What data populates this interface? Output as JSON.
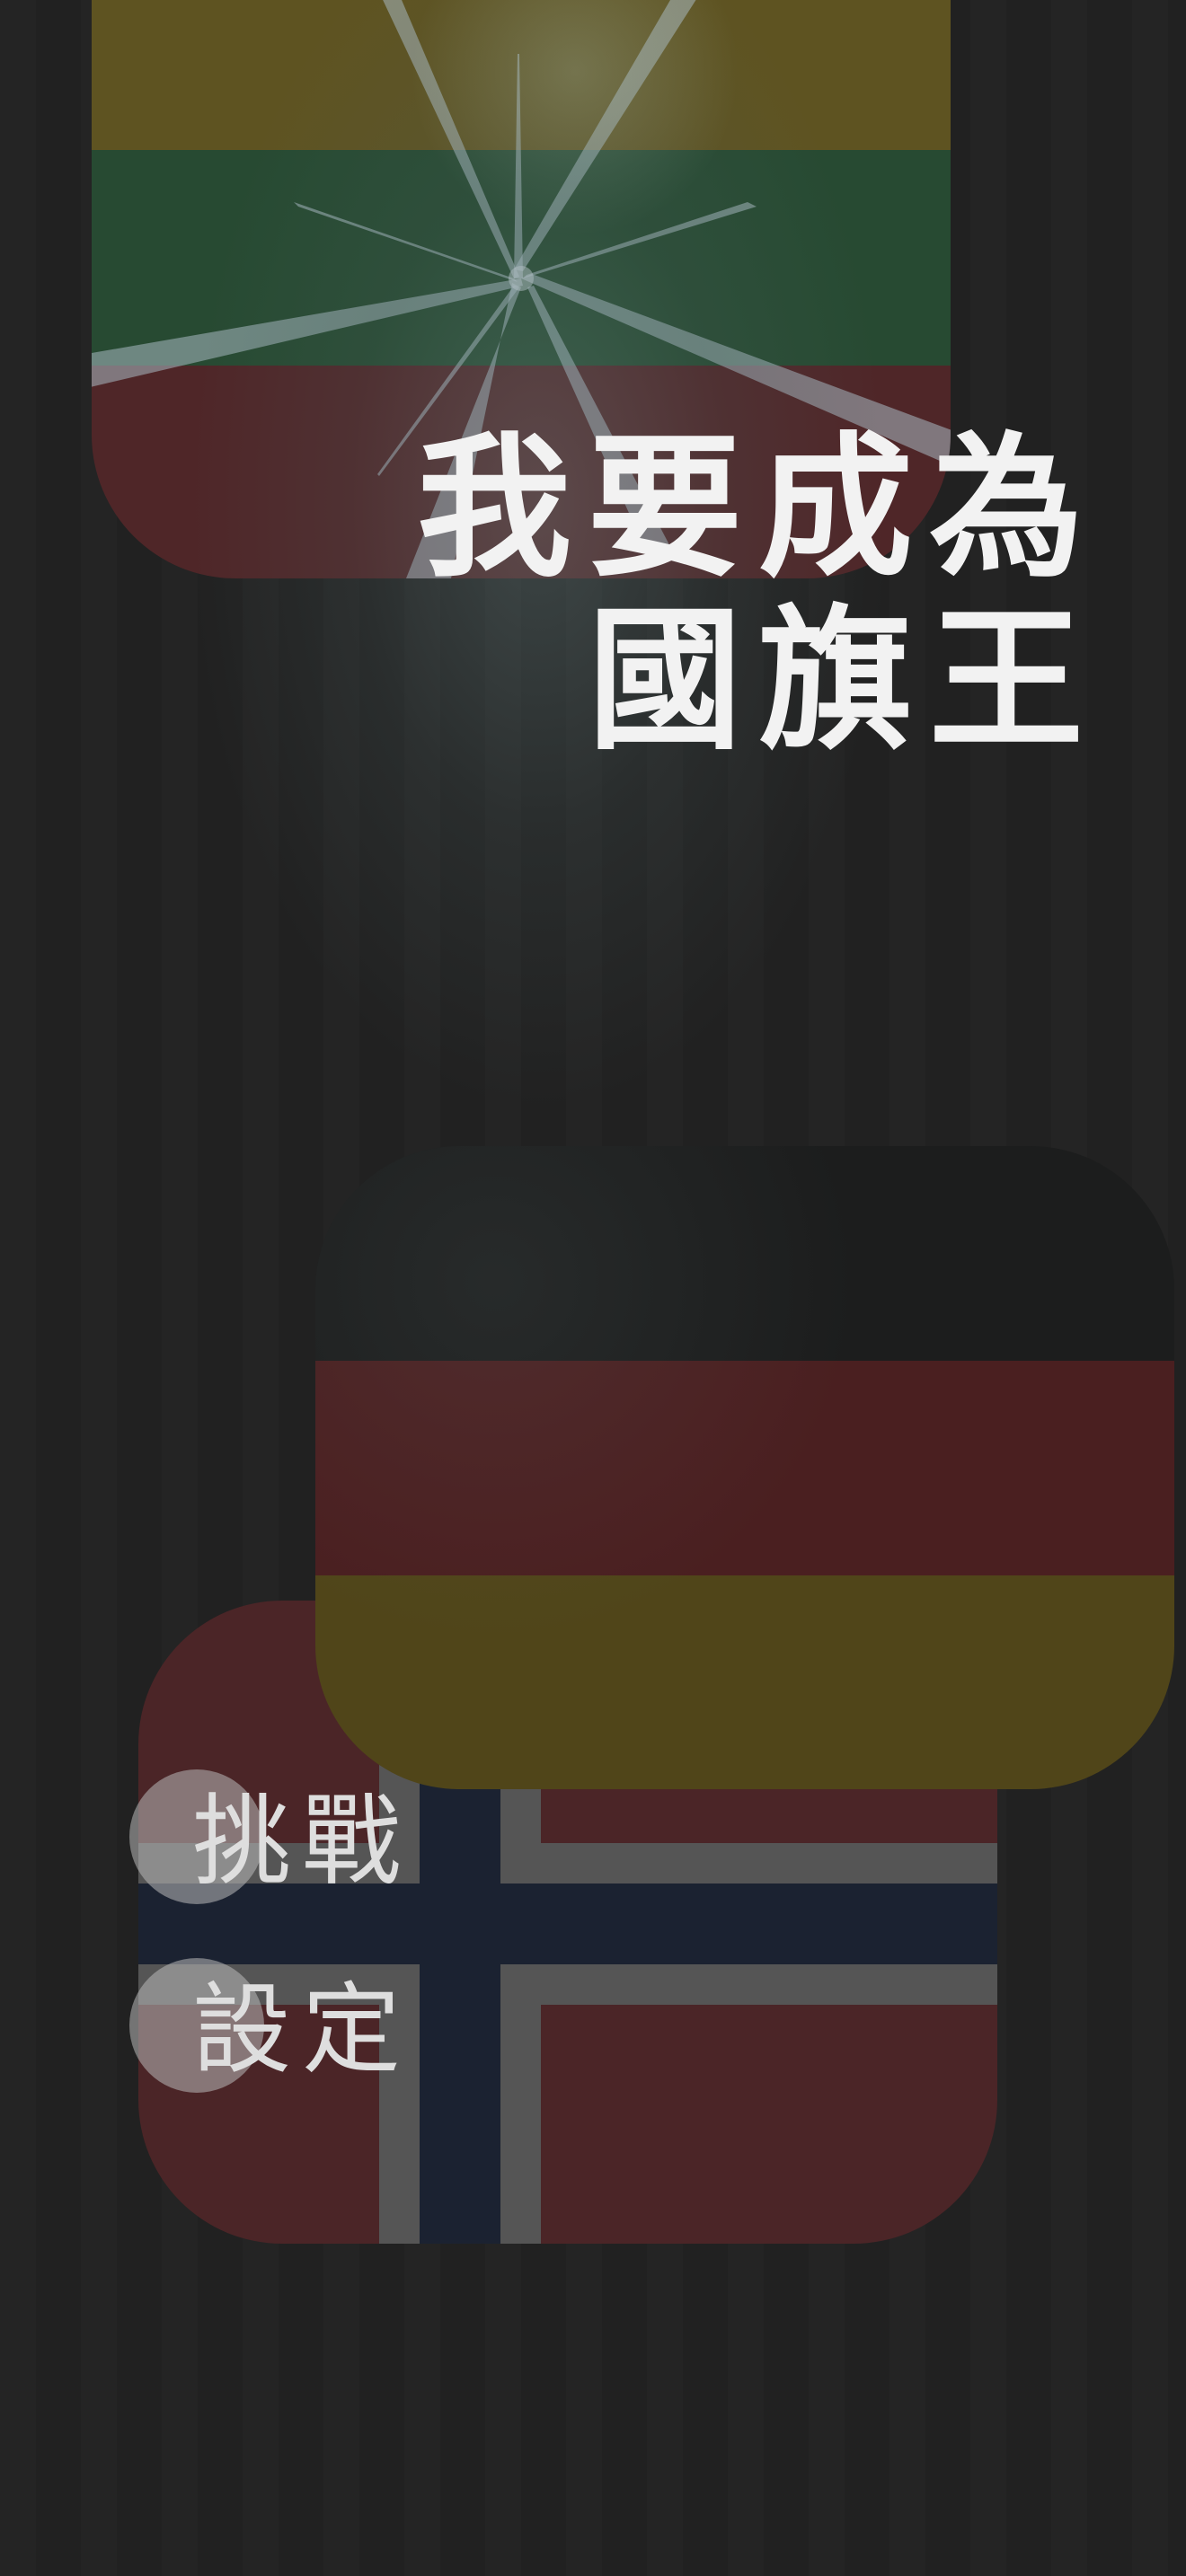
{
  "title": {
    "line1": "我要成為",
    "line2": "國旗王"
  },
  "menu": {
    "items": [
      {
        "label": "挑戰"
      },
      {
        "label": "設定"
      }
    ]
  },
  "flags": [
    "lithuania",
    "germany",
    "norway"
  ]
}
